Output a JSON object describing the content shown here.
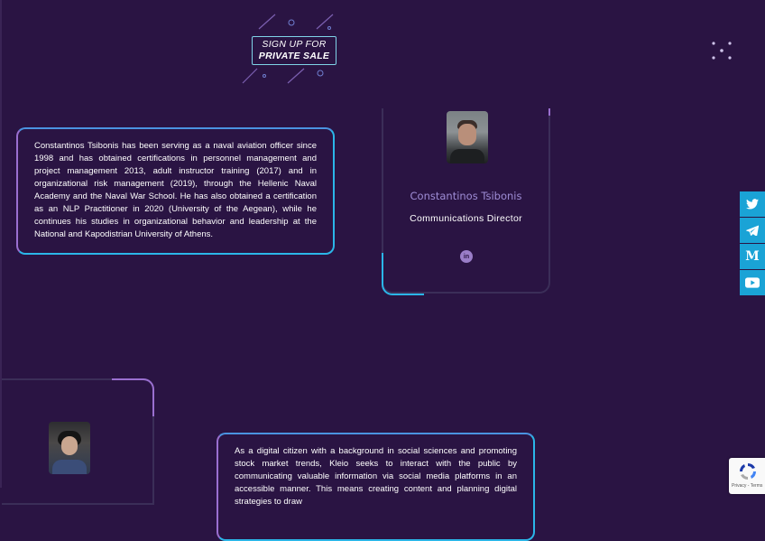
{
  "signup": {
    "line1": "SIGN UP FOR",
    "line2": "PRIVATE SALE"
  },
  "team": [
    {
      "bio": "Constantinos Tsibonis has been serving as a naval aviation officer since 1998 and has obtained certifications in personnel management and project management 2013, adult instructor training (2017) and in organizational risk management (2019), through the Hellenic Naval Academy and the Naval War School. He has also obtained a certification as an NLP Practitioner in 2020 (University of the Aegean), while he continues his studies in organizational behavior and leadership at the National and Kapodistrian University of Athens.",
      "name": "Constantinos Tsibonis",
      "role": "Communications Director",
      "social_icon": "linkedin-icon"
    },
    {
      "bio": "As a digital citizen with a background in social sciences and promoting stock market trends, Kleio seeks to interact with the public by communicating valuable information via social media platforms in an accessible manner. This means creating content and planning digital strategies to draw"
    }
  ],
  "sidebar": [
    {
      "icon": "twitter-icon",
      "glyph": "🐦"
    },
    {
      "icon": "telegram-icon",
      "glyph": "✈"
    },
    {
      "icon": "medium-icon",
      "glyph": "M"
    },
    {
      "icon": "youtube-icon",
      "glyph": "▶"
    }
  ],
  "recaptcha": {
    "links": "Privacy - Terms"
  },
  "colors": {
    "background": "#2a1443",
    "accent_cyan": "#2bb6e8",
    "accent_purple": "#9a6fd0",
    "name_purple": "#9f8dd6"
  }
}
